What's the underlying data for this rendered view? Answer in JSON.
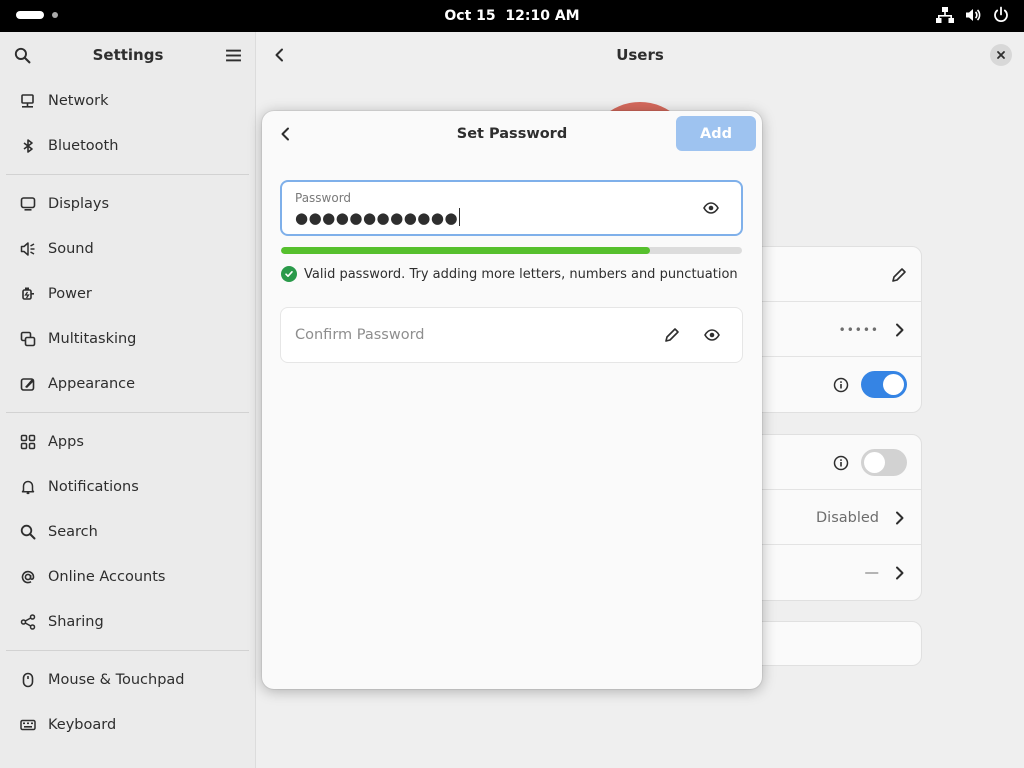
{
  "topbar": {
    "date": "Oct 15",
    "time": "12:10 AM"
  },
  "sidebar": {
    "title": "Settings",
    "groups": [
      [
        {
          "label": "Network",
          "icon": "network-icon"
        },
        {
          "label": "Bluetooth",
          "icon": "bluetooth-icon"
        }
      ],
      [
        {
          "label": "Displays",
          "icon": "display-icon"
        },
        {
          "label": "Sound",
          "icon": "sound-icon"
        },
        {
          "label": "Power",
          "icon": "power-plug-icon"
        },
        {
          "label": "Multitasking",
          "icon": "multitasking-icon"
        },
        {
          "label": "Appearance",
          "icon": "appearance-icon"
        }
      ],
      [
        {
          "label": "Apps",
          "icon": "apps-icon"
        },
        {
          "label": "Notifications",
          "icon": "bell-icon"
        },
        {
          "label": "Search",
          "icon": "search-icon"
        },
        {
          "label": "Online Accounts",
          "icon": "at-icon"
        },
        {
          "label": "Sharing",
          "icon": "share-icon"
        }
      ],
      [
        {
          "label": "Mouse & Touchpad",
          "icon": "mouse-icon"
        },
        {
          "label": "Keyboard",
          "icon": "keyboard-icon"
        }
      ]
    ]
  },
  "content": {
    "title": "Users",
    "password_mask": "•••••",
    "login_value": "Disabled",
    "history_value": "—",
    "admin_switch_on": true,
    "autologin_switch_on": false
  },
  "dialog": {
    "title": "Set Password",
    "add_label": "Add",
    "password_label": "Password",
    "password_value": "●●●●●●●●●●●●",
    "strength": 0.8,
    "hint": "Valid password. Try adding more letters, numbers and punctuation",
    "confirm_placeholder": "Confirm Password"
  },
  "colors": {
    "accent": "#3584e4",
    "add_button_disabled": "#9ec3f0",
    "strength_fill": "#56c02d",
    "valid_check": "#2a9a4a",
    "avatar": "#d4695c"
  }
}
